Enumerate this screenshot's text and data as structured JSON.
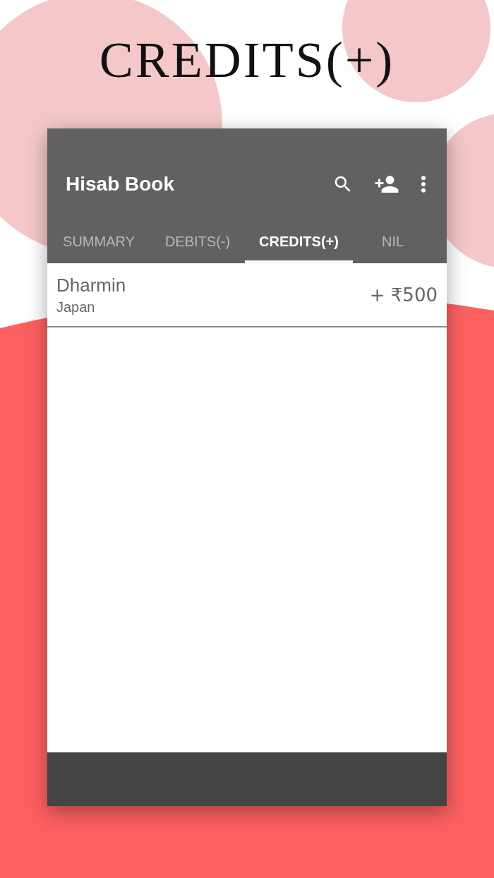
{
  "headline": "CREDITS(+)",
  "app_bar": {
    "title": "Hisab Book"
  },
  "tabs": [
    {
      "label": "SUMMARY",
      "selected": false
    },
    {
      "label": "DEBITS(-)",
      "selected": false
    },
    {
      "label": "CREDITS(+)",
      "selected": true
    },
    {
      "label": "NIL",
      "selected": false
    }
  ],
  "entries": [
    {
      "name": "Dharmin",
      "place": "Japan",
      "amount": "+ ₹500"
    }
  ]
}
